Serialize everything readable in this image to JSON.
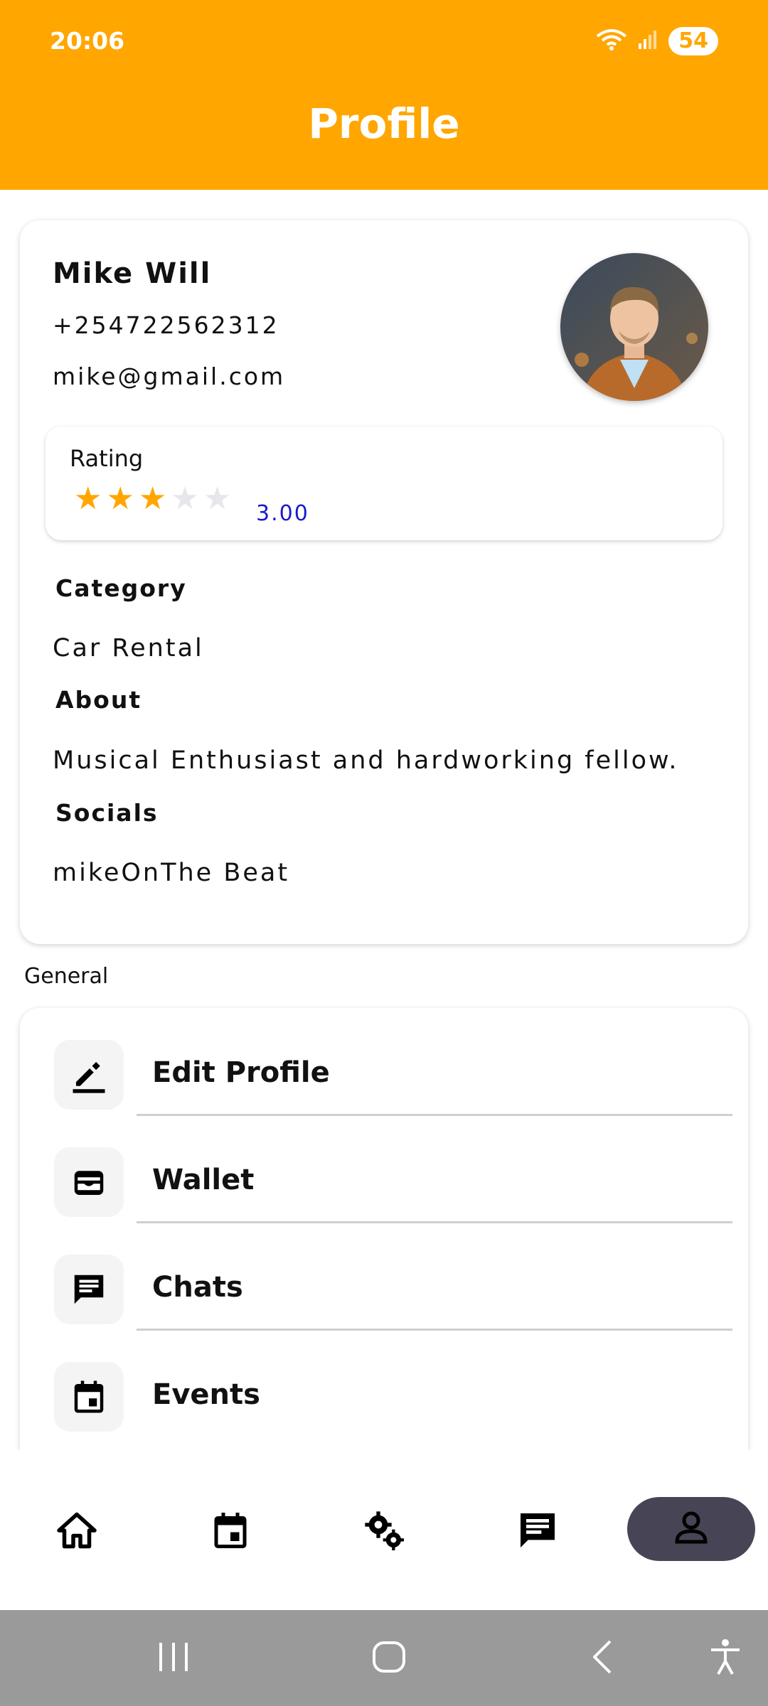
{
  "status_bar": {
    "time": "20:06",
    "battery": "54"
  },
  "header": {
    "title": "Profile"
  },
  "profile": {
    "name": "Mike Will",
    "phone": "+254722562312",
    "email": "mike@gmail.com",
    "rating_label": "Rating",
    "rating_value": "3.00",
    "rating_stars": 3,
    "rating_max": 5,
    "category_title": "Category",
    "category_value": "Car Rental",
    "about_title": "About",
    "about_value": "Musical Enthusiast and hardworking fellow.",
    "socials_title": "Socials",
    "socials_value": "mikeOnThe Beat"
  },
  "general": {
    "label": "General",
    "items": [
      {
        "label": "Edit Profile",
        "icon": "edit-icon"
      },
      {
        "label": "Wallet",
        "icon": "wallet-icon"
      },
      {
        "label": "Chats",
        "icon": "chat-icon"
      },
      {
        "label": "Events",
        "icon": "calendar-icon"
      }
    ]
  },
  "bottom_nav": {
    "items": [
      "home-icon",
      "calendar-icon",
      "settings-icon",
      "chat-icon",
      "person-icon"
    ],
    "active": "person-icon"
  },
  "colors": {
    "accent": "#FFA600",
    "nav_active": "#474555",
    "rating_value": "#1a1acc"
  }
}
